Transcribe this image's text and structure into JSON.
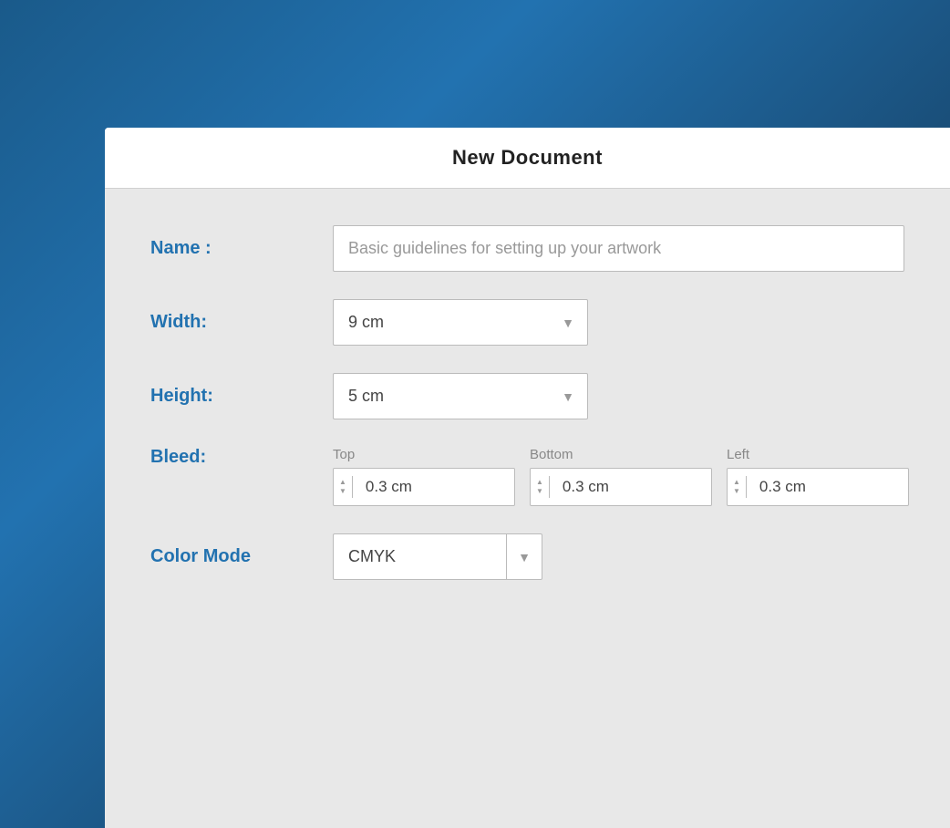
{
  "background": {
    "color_start": "#1a5a8a",
    "color_end": "#1e3d5c"
  },
  "dialog": {
    "title": "New Document",
    "fields": {
      "name": {
        "label": "Name :",
        "value": "Basic guidelines for setting up your artwork"
      },
      "width": {
        "label": "Width:",
        "value": "9 cm",
        "arrow": "▼"
      },
      "height": {
        "label": "Height:",
        "value": "5 cm",
        "arrow": "▼"
      },
      "bleed": {
        "label": "Bleed:",
        "top": {
          "label": "Top",
          "value": "0.3 cm",
          "up": "▲",
          "down": "▼"
        },
        "bottom": {
          "label": "Bottom",
          "value": "0.3 cm",
          "up": "▲",
          "down": "▼"
        },
        "left": {
          "label": "Left",
          "value": "0.3 cm",
          "up": "▲",
          "down": "▼"
        }
      },
      "color_mode": {
        "label": "Color Mode",
        "value": "CMYK",
        "arrow": "▼"
      }
    }
  }
}
